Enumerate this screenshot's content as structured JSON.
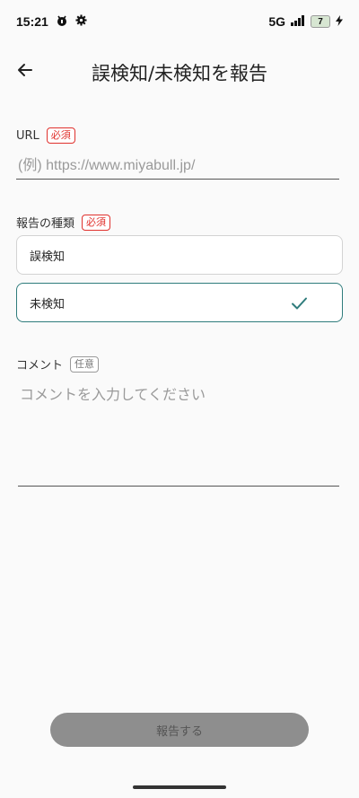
{
  "status_bar": {
    "time": "15:21",
    "network": "5G",
    "battery_level": "7",
    "icons": [
      "notification-app-icon",
      "settings-gear-icon",
      "signal-bars-icon",
      "battery-icon",
      "charging-bolt-icon"
    ]
  },
  "header": {
    "title": "誤検知/未検知を報告",
    "back_icon": "arrow-left-icon"
  },
  "form": {
    "url": {
      "label": "URL",
      "badge": "必須",
      "placeholder": "(例) https://www.miyabull.jp/",
      "value": ""
    },
    "report_type": {
      "label": "報告の種類",
      "badge": "必須",
      "options": [
        {
          "label": "誤検知",
          "selected": false
        },
        {
          "label": "未検知",
          "selected": true
        }
      ]
    },
    "comment": {
      "label": "コメント",
      "badge": "任意",
      "placeholder": "コメントを入力してください",
      "value": ""
    }
  },
  "submit": {
    "label": "報告する",
    "enabled": false
  },
  "colors": {
    "required_badge": "#e0312d",
    "selected_border": "#2f7c7c",
    "button_disabled": "#8e8e8e",
    "background": "#fafafa"
  }
}
